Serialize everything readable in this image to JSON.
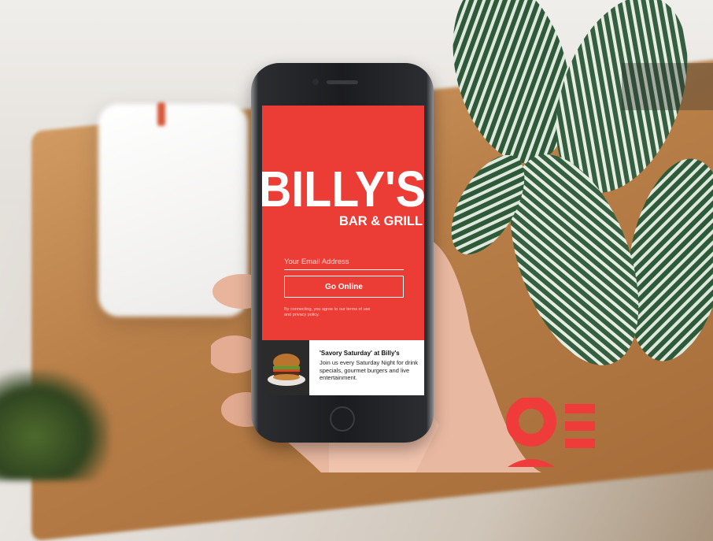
{
  "app": {
    "logo_line1": "BILLY'S",
    "logo_line2": "BAR & GRILL",
    "email": {
      "placeholder": "Your Email Address",
      "value": ""
    },
    "go_button_label": "Go Online",
    "terms_text": "By connecting, you agree to our terms of use and privacy policy.",
    "promo": {
      "title": "'Savory Saturday' at Billy's",
      "body": "Join us every Saturday Night for drink specials, gourmet burgers and live entertainment."
    }
  },
  "colors": {
    "brand_red": "#eb3d35",
    "white": "#ffffff"
  },
  "icons": [
    "burger-photo",
    "brand-mark-icon"
  ]
}
